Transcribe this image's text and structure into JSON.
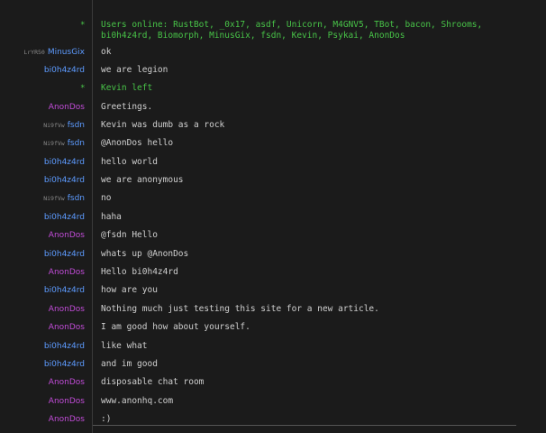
{
  "messages": [
    {
      "nick": "*",
      "type": "info",
      "text": "Users online: RustBot, _0x17, asdf, Unicorn, M4GNV5, TBot, bacon, Shrooms, bi0h4z4rd, Biomorph, MinusGix, fsdn, Kevin, Psykai, AnonDos"
    },
    {
      "trip": "LrYR50",
      "nick": "MinusGix",
      "type": "chat",
      "color": "blue",
      "text": "ok"
    },
    {
      "nick": "bi0h4z4rd",
      "type": "chat",
      "color": "blue",
      "text": "we are legion"
    },
    {
      "nick": "*",
      "type": "info",
      "text": "Kevin left"
    },
    {
      "nick": "AnonDos",
      "type": "chat",
      "color": "purple",
      "text": "Greetings."
    },
    {
      "trip": "Ni9fVw",
      "nick": "fsdn",
      "type": "chat",
      "color": "blue",
      "text": "Kevin was dumb as a rock"
    },
    {
      "trip": "Ni9fVw",
      "nick": "fsdn",
      "type": "chat",
      "color": "blue",
      "text": "@AnonDos hello"
    },
    {
      "nick": "bi0h4z4rd",
      "type": "chat",
      "color": "blue",
      "text": "hello world"
    },
    {
      "nick": "bi0h4z4rd",
      "type": "chat",
      "color": "blue",
      "text": "we are anonymous"
    },
    {
      "trip": "Ni9fVw",
      "nick": "fsdn",
      "type": "chat",
      "color": "blue",
      "text": "no"
    },
    {
      "nick": "bi0h4z4rd",
      "type": "chat",
      "color": "blue",
      "text": "haha"
    },
    {
      "nick": "AnonDos",
      "type": "chat",
      "color": "purple",
      "text": "@fsdn Hello"
    },
    {
      "nick": "bi0h4z4rd",
      "type": "chat",
      "color": "blue",
      "text": "whats up @AnonDos"
    },
    {
      "nick": "AnonDos",
      "type": "chat",
      "color": "purple",
      "text": "Hello bi0h4z4rd"
    },
    {
      "nick": "bi0h4z4rd",
      "type": "chat",
      "color": "blue",
      "text": "how are you"
    },
    {
      "nick": "AnonDos",
      "type": "chat",
      "color": "purple",
      "text": "Nothing much just testing this site for a new article."
    },
    {
      "nick": "AnonDos",
      "type": "chat",
      "color": "purple",
      "text": "I am good how about yourself."
    },
    {
      "nick": "bi0h4z4rd",
      "type": "chat",
      "color": "blue",
      "text": "like what"
    },
    {
      "nick": "bi0h4z4rd",
      "type": "chat",
      "color": "blue",
      "text": "and im good"
    },
    {
      "nick": "AnonDos",
      "type": "chat",
      "color": "purple",
      "text": "disposable chat room"
    },
    {
      "nick": "AnonDos",
      "type": "chat",
      "color": "purple",
      "text": "www.anonhq.com"
    },
    {
      "nick": "AnonDos",
      "type": "chat",
      "color": "purple",
      "text": ":)"
    }
  ],
  "colors": {
    "background": "#1b1b1b",
    "text": "#d0d0d0",
    "nick_blue": "#5d9bff",
    "nick_purple": "#c24cd8",
    "info_green": "#48c448",
    "trip_gray": "#8a8a8a"
  }
}
